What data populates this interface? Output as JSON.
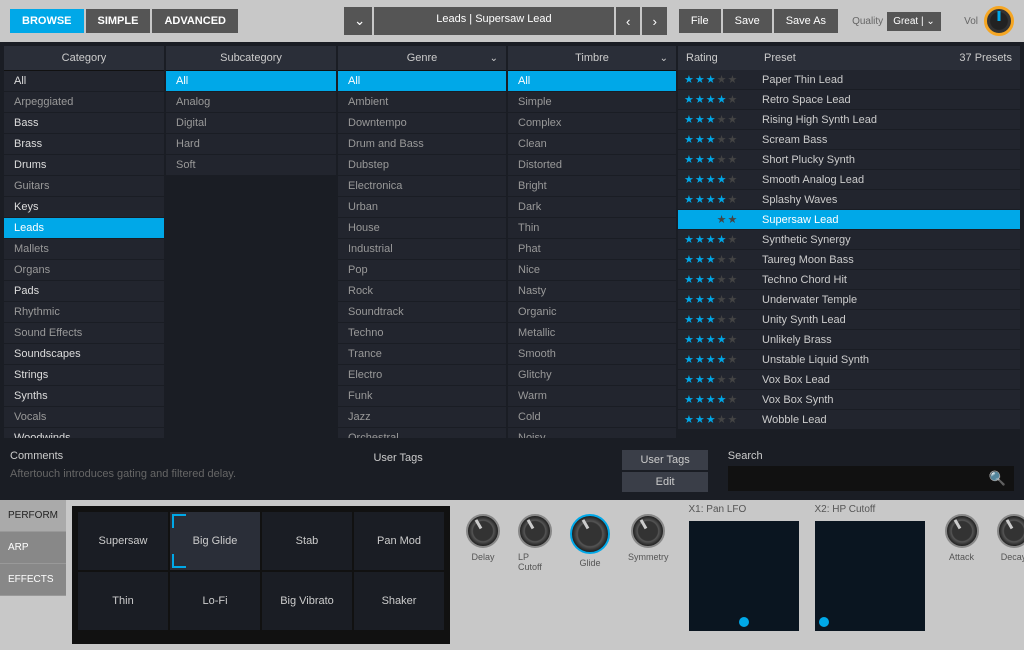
{
  "topbar": {
    "tabs": [
      "BROWSE",
      "SIMPLE",
      "ADVANCED"
    ],
    "active_tab": 0,
    "preset_title": "Leads | Supersaw Lead",
    "file_buttons": [
      "File",
      "Save",
      "Save As"
    ],
    "quality_label": "Quality",
    "quality_value": "Great",
    "vol_label": "Vol"
  },
  "columns": {
    "category": {
      "header": "Category",
      "items": [
        "All",
        "Arpeggiated",
        "Bass",
        "Brass",
        "Drums",
        "Guitars",
        "Keys",
        "Leads",
        "Mallets",
        "Organs",
        "Pads",
        "Rhythmic",
        "Sound Effects",
        "Soundscapes",
        "Strings",
        "Synths",
        "Vocals",
        "Woodwinds"
      ],
      "bright": [
        0,
        2,
        3,
        4,
        6,
        7,
        10,
        13,
        14,
        15,
        17
      ],
      "selected": 7
    },
    "subcategory": {
      "header": "Subcategory",
      "items": [
        "All",
        "Analog",
        "Digital",
        "Hard",
        "Soft"
      ],
      "selected": 0
    },
    "genre": {
      "header": "Genre",
      "items": [
        "All",
        "Ambient",
        "Downtempo",
        "Drum and Bass",
        "Dubstep",
        "Electronica",
        "Urban",
        "House",
        "Industrial",
        "Pop",
        "Rock",
        "Soundtrack",
        "Techno",
        "Trance",
        "Electro",
        "Funk",
        "Jazz",
        "Orchestral"
      ],
      "selected": 0
    },
    "timbre": {
      "header": "Timbre",
      "items": [
        "All",
        "Simple",
        "Complex",
        "Clean",
        "Distorted",
        "Bright",
        "Dark",
        "Thin",
        "Phat",
        "Nice",
        "Nasty",
        "Organic",
        "Metallic",
        "Smooth",
        "Glitchy",
        "Warm",
        "Cold",
        "Noisy"
      ],
      "selected": 0
    }
  },
  "presets": {
    "rating_header": "Rating",
    "name_header": "Preset",
    "count": "37 Presets",
    "selected": 7,
    "rows": [
      {
        "name": "Paper Thin Lead",
        "rating": 3
      },
      {
        "name": "Retro Space Lead",
        "rating": 4
      },
      {
        "name": "Rising High Synth Lead",
        "rating": 3
      },
      {
        "name": "Scream Bass",
        "rating": 3
      },
      {
        "name": "Short Plucky Synth",
        "rating": 3
      },
      {
        "name": "Smooth Analog Lead",
        "rating": 4
      },
      {
        "name": "Splashy Waves",
        "rating": 4
      },
      {
        "name": "Supersaw Lead",
        "rating": 3
      },
      {
        "name": "Synthetic Synergy",
        "rating": 4
      },
      {
        "name": "Taureg Moon Bass",
        "rating": 3
      },
      {
        "name": "Techno Chord Hit",
        "rating": 3
      },
      {
        "name": "Underwater Temple",
        "rating": 3
      },
      {
        "name": "Unity Synth Lead",
        "rating": 3
      },
      {
        "name": "Unlikely Brass",
        "rating": 4
      },
      {
        "name": "Unstable Liquid Synth",
        "rating": 4
      },
      {
        "name": "Vox Box Lead",
        "rating": 3
      },
      {
        "name": "Vox Box Synth",
        "rating": 4
      },
      {
        "name": "Wobble Lead",
        "rating": 3
      }
    ]
  },
  "bottom": {
    "comments_label": "Comments",
    "comments_text": "Aftertouch introduces gating and filtered delay.",
    "usertags_label": "User Tags",
    "user_tags_btn": "User Tags",
    "edit_btn": "Edit",
    "search_label": "Search"
  },
  "perform": {
    "tabs": [
      "PERFORM",
      "ARP",
      "EFFECTS"
    ],
    "active_tab": 0,
    "pads": [
      "Supersaw",
      "Big Glide",
      "Stab",
      "Pan Mod",
      "Thin",
      "Lo-Fi",
      "Big Vibrato",
      "Shaker"
    ],
    "active_pad": 1,
    "knobs1": [
      "Delay",
      "LP Cutoff",
      "Glide",
      "Symmetry"
    ],
    "xy1_label": "X1: Pan LFO",
    "xy2_label": "X2: HP Cutoff",
    "knobs2": [
      "Attack",
      "Decay"
    ]
  }
}
